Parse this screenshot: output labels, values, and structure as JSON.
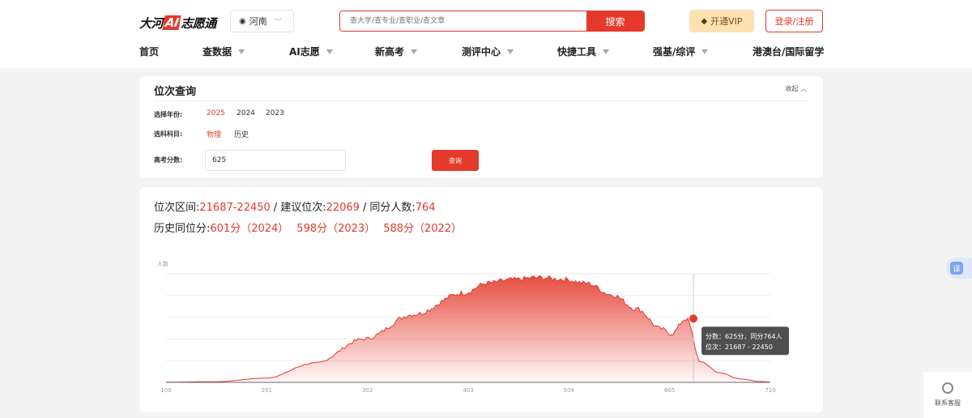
{
  "header": {
    "logo": {
      "pre": "大河",
      "ai": "AI",
      "post": "志愿通"
    },
    "region": "河南",
    "search_placeholder": "查大学/查专业/查职业/查文章",
    "search_button": "搜索",
    "vip_button": "开通VIP",
    "login_button": "登录/注册"
  },
  "nav": {
    "items": [
      {
        "label": "首页",
        "dropdown": false
      },
      {
        "label": "查数据",
        "dropdown": true
      },
      {
        "label": "AI志愿",
        "dropdown": true
      },
      {
        "label": "新高考",
        "dropdown": true
      },
      {
        "label": "测评中心",
        "dropdown": true
      },
      {
        "label": "快捷工具",
        "dropdown": true
      },
      {
        "label": "强基/综评",
        "dropdown": true
      },
      {
        "label": "港澳台/国际留学",
        "dropdown": false
      }
    ]
  },
  "query": {
    "title": "位次查询",
    "collapse": "收起",
    "year_label": "选择年份:",
    "years": [
      "2025",
      "2024",
      "2023"
    ],
    "selected_year": "2025",
    "subject_label": "选科科目:",
    "subjects": [
      "物理",
      "历史"
    ],
    "selected_subject": "物理",
    "score_label": "高考分数:",
    "score_value": "625",
    "query_button": "查询"
  },
  "result": {
    "range_label": "位次区间:",
    "range_value": "21687-22450",
    "suggest_label": "建议位次:",
    "suggest_value": "22069",
    "same_label": "同分人数:",
    "same_value": "764",
    "history_label": "历史同位分:",
    "history": [
      "601分（2024）",
      "598分（2023）",
      "588分（2022）"
    ]
  },
  "chart_data": {
    "type": "area",
    "ylabel": "人数",
    "x_ticks": [
      "100",
      "201",
      "302",
      "403",
      "504",
      "605",
      "710"
    ],
    "xlim": [
      100,
      710
    ],
    "grid": true,
    "color": "#e4392b",
    "x": [
      100,
      150,
      200,
      250,
      300,
      350,
      400,
      425,
      450,
      475,
      500,
      525,
      550,
      575,
      600,
      610,
      625,
      640,
      660,
      680,
      700,
      710
    ],
    "y": [
      2,
      8,
      50,
      230,
      520,
      815,
      1070,
      1190,
      1230,
      1255,
      1235,
      1185,
      1050,
      880,
      640,
      580,
      764,
      240,
      110,
      40,
      10,
      3
    ],
    "tooltip": {
      "score": 625,
      "count": 764,
      "line1": "分数：625分，同分764人",
      "line2": "位次：21687 - 22450"
    }
  },
  "side": {
    "translate": "译",
    "service": "联系客服"
  }
}
